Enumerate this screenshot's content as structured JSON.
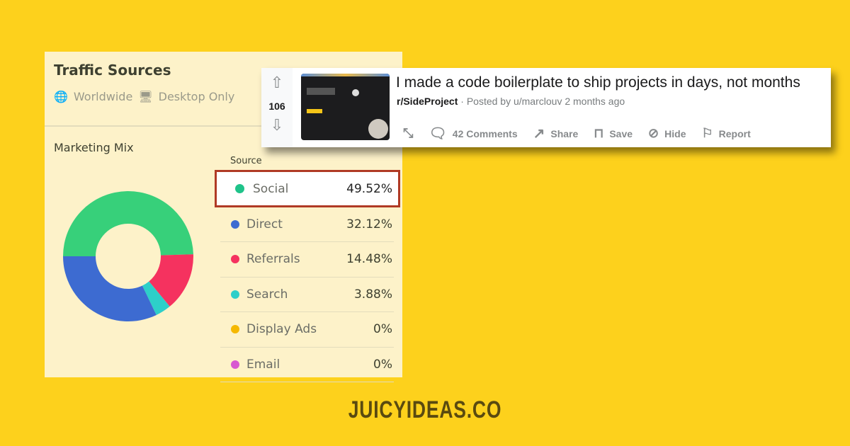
{
  "card": {
    "title": "Traffic Sources",
    "region": "Worldwide",
    "device": "Desktop Only",
    "section": "Marketing Mix",
    "column_header": "Source",
    "sources": [
      {
        "label": "Social",
        "value": "49.52%",
        "pct": 49.52,
        "color": "#1fc38a"
      },
      {
        "label": "Direct",
        "value": "32.12%",
        "pct": 32.12,
        "color": "#3d6bd1"
      },
      {
        "label": "Referrals",
        "value": "14.48%",
        "pct": 14.48,
        "color": "#f5325f"
      },
      {
        "label": "Search",
        "value": "3.88%",
        "pct": 3.88,
        "color": "#2dcfc9"
      },
      {
        "label": "Display Ads",
        "value": "0%",
        "pct": 0,
        "color": "#f5b800"
      },
      {
        "label": "Email",
        "value": "0%",
        "pct": 0,
        "color": "#d858d0"
      }
    ]
  },
  "post": {
    "votes": "106",
    "title": "I made a code boilerplate to ship projects in days, not months",
    "subreddit": "r/SideProject",
    "meta": "· Posted by u/marclouv 2 months ago",
    "actions": {
      "comments": "42 Comments",
      "share": "Share",
      "save": "Save",
      "hide": "Hide",
      "report": "Report"
    }
  },
  "brand": "JUICYIDEAS.CO",
  "colors": {
    "background": "#fdd11c",
    "highlight_border": "#b03a25"
  }
}
